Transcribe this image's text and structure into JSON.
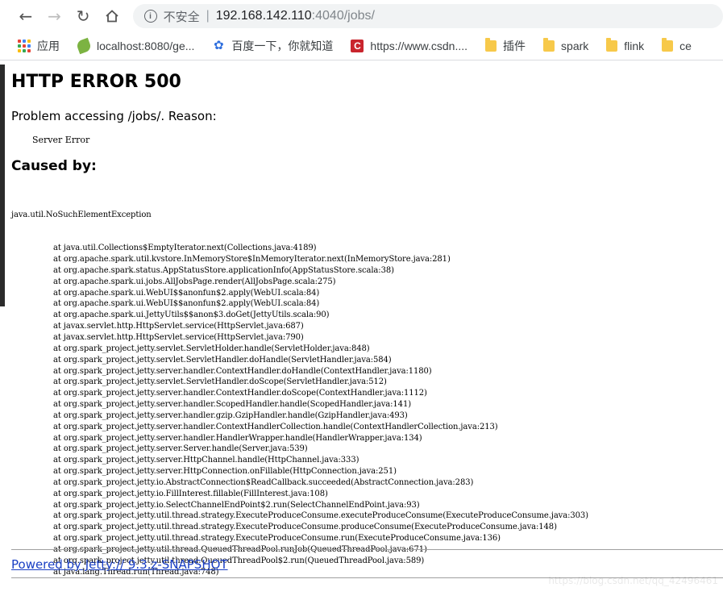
{
  "browser": {
    "insecure_label": "不安全",
    "separator": "|",
    "url_host": "192.168.142.110",
    "url_path": ":4040/jobs/",
    "bookmarks": [
      {
        "label": "应用",
        "icon": "apps-grid-icon"
      },
      {
        "label": "localhost:8080/ge...",
        "icon": "leaf-icon"
      },
      {
        "label": "百度一下，你就知道",
        "icon": "baidu-paw-icon"
      },
      {
        "label": "https://www.csdn....",
        "icon": "csdn-icon"
      },
      {
        "label": "插件",
        "icon": "folder-icon"
      },
      {
        "label": "spark",
        "icon": "folder-icon"
      },
      {
        "label": "flink",
        "icon": "folder-icon"
      },
      {
        "label": "ce",
        "icon": "folder-icon"
      }
    ],
    "colors": {
      "folder": "#f7c94a",
      "csdn": "#c9252d",
      "link": "#1a3fc4"
    }
  },
  "page": {
    "heading": "HTTP ERROR 500",
    "problem": "Problem accessing /jobs/. Reason:",
    "reason": "Server Error",
    "caused_by": "Caused by:",
    "exception": "java.util.NoSuchElementException",
    "stack": [
      "at java.util.Collections$EmptyIterator.next(Collections.java:4189)",
      "at org.apache.spark.util.kvstore.InMemoryStore$InMemoryIterator.next(InMemoryStore.java:281)",
      "at org.apache.spark.status.AppStatusStore.applicationInfo(AppStatusStore.scala:38)",
      "at org.apache.spark.ui.jobs.AllJobsPage.render(AllJobsPage.scala:275)",
      "at org.apache.spark.ui.WebUI$$anonfun$2.apply(WebUI.scala:84)",
      "at org.apache.spark.ui.WebUI$$anonfun$2.apply(WebUI.scala:84)",
      "at org.apache.spark.ui.JettyUtils$$anon$3.doGet(JettyUtils.scala:90)",
      "at javax.servlet.http.HttpServlet.service(HttpServlet.java:687)",
      "at javax.servlet.http.HttpServlet.service(HttpServlet.java:790)",
      "at org.spark_project.jetty.servlet.ServletHolder.handle(ServletHolder.java:848)",
      "at org.spark_project.jetty.servlet.ServletHandler.doHandle(ServletHandler.java:584)",
      "at org.spark_project.jetty.server.handler.ContextHandler.doHandle(ContextHandler.java:1180)",
      "at org.spark_project.jetty.servlet.ServletHandler.doScope(ServletHandler.java:512)",
      "at org.spark_project.jetty.server.handler.ContextHandler.doScope(ContextHandler.java:1112)",
      "at org.spark_project.jetty.server.handler.ScopedHandler.handle(ScopedHandler.java:141)",
      "at org.spark_project.jetty.server.handler.gzip.GzipHandler.handle(GzipHandler.java:493)",
      "at org.spark_project.jetty.server.handler.ContextHandlerCollection.handle(ContextHandlerCollection.java:213)",
      "at org.spark_project.jetty.server.handler.HandlerWrapper.handle(HandlerWrapper.java:134)",
      "at org.spark_project.jetty.server.Server.handle(Server.java:539)",
      "at org.spark_project.jetty.server.HttpChannel.handle(HttpChannel.java:333)",
      "at org.spark_project.jetty.server.HttpConnection.onFillable(HttpConnection.java:251)",
      "at org.spark_project.jetty.io.AbstractConnection$ReadCallback.succeeded(AbstractConnection.java:283)",
      "at org.spark_project.jetty.io.FillInterest.fillable(FillInterest.java:108)",
      "at org.spark_project.jetty.io.SelectChannelEndPoint$2.run(SelectChannelEndPoint.java:93)",
      "at org.spark_project.jetty.util.thread.strategy.ExecuteProduceConsume.executeProduceConsume(ExecuteProduceConsume.java:303)",
      "at org.spark_project.jetty.util.thread.strategy.ExecuteProduceConsume.produceConsume(ExecuteProduceConsume.java:148)",
      "at org.spark_project.jetty.util.thread.strategy.ExecuteProduceConsume.run(ExecuteProduceConsume.java:136)",
      "at org.spark_project.jetty.util.thread.QueuedThreadPool.runJob(QueuedThreadPool.java:671)",
      "at org.spark_project.jetty.util.thread.QueuedThreadPool$2.run(QueuedThreadPool.java:589)",
      "at java.lang.Thread.run(Thread.java:748)"
    ],
    "powered_by": "Powered by Jetty:// 9.3.z-SNAPSHOT",
    "watermark": "https://blog.csdn.net/qq_42496461"
  }
}
